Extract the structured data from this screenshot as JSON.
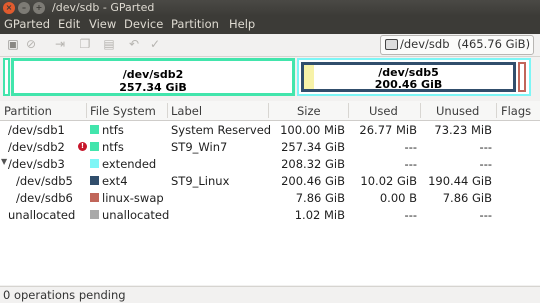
{
  "window": {
    "title": "/dev/sdb - GParted"
  },
  "menu": [
    "GParted",
    "Edit",
    "View",
    "Device",
    "Partition",
    "Help"
  ],
  "device_selector": {
    "device": "/dev/sdb",
    "size": "(465.76 GiB)"
  },
  "partition_map": [
    {
      "name": "/dev/sdb2",
      "size": "257.34 GiB"
    },
    {
      "name": "/dev/sdb5",
      "size": "200.46 GiB"
    }
  ],
  "columns": [
    "Partition",
    "File System",
    "Label",
    "Size",
    "Used",
    "Unused",
    "Flags"
  ],
  "rows": [
    {
      "partition": "/dev/sdb1",
      "fs": "ntfs",
      "label": "System Reserved",
      "size": "100.00 MiB",
      "used": "26.77 MiB",
      "unused": "73.23 MiB",
      "flags": "",
      "color": "#42e5ac"
    },
    {
      "partition": "/dev/sdb2",
      "fs": "ntfs",
      "label": "ST9_Win7",
      "size": "257.34 GiB",
      "used": "---",
      "unused": "---",
      "flags": "",
      "color": "#42e5ac"
    },
    {
      "partition": "/dev/sdb3",
      "fs": "extended",
      "label": "",
      "size": "208.32 GiB",
      "used": "---",
      "unused": "---",
      "flags": "",
      "color": "#7df6f6"
    },
    {
      "partition": "/dev/sdb5",
      "fs": "ext4",
      "label": "ST9_Linux",
      "size": "200.46 GiB",
      "used": "10.02 GiB",
      "unused": "190.44 GiB",
      "flags": "",
      "color": "#314e6c"
    },
    {
      "partition": "/dev/sdb6",
      "fs": "linux-swap",
      "label": "",
      "size": "7.86 GiB",
      "used": "0.00 B",
      "unused": "7.86 GiB",
      "flags": "",
      "color": "#c1665a"
    },
    {
      "partition": "unallocated",
      "fs": "unallocated",
      "label": "",
      "size": "1.02 MiB",
      "used": "---",
      "unused": "---",
      "flags": "",
      "color": "#a9a9a9"
    }
  ],
  "status": "0 operations pending",
  "colors": {
    "ntfs": "#42e5ac",
    "extended": "#7df6f6",
    "ext4": "#314e6c",
    "swap": "#c1665a",
    "unallocated": "#a9a9a9"
  }
}
